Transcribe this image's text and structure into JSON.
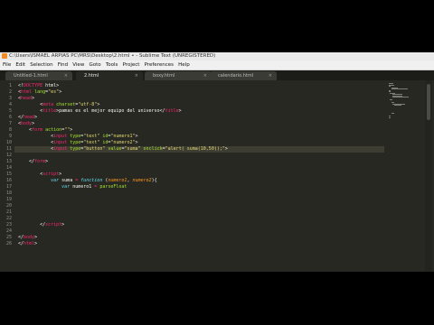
{
  "window": {
    "title": "C:\\Users\\ISMAEL ARPIAS PC\\MRS\\Desktop\\2.html • - Sublime Text (UNREGISTERED)"
  },
  "menu": [
    "File",
    "Edit",
    "Selection",
    "Find",
    "View",
    "Goto",
    "Tools",
    "Project",
    "Preferences",
    "Help"
  ],
  "tabs": [
    {
      "label": "Untitled-1.html",
      "active": false
    },
    {
      "label": "2.html",
      "active": true
    },
    {
      "label": "boxy.html",
      "active": false
    },
    {
      "label": "calendario.html",
      "active": false
    }
  ],
  "editor": {
    "current_line": 11,
    "lines": [
      [
        [
          "<!",
          ""
        ],
        [
          "DOCTYPE",
          "tag"
        ],
        [
          " html>",
          ""
        ]
      ],
      [
        [
          "<",
          ""
        ],
        [
          "html",
          "tag"
        ],
        [
          " ",
          ""
        ],
        [
          "lang",
          "attr"
        ],
        [
          "=",
          ""
        ],
        [
          "\"es\"",
          "str"
        ],
        [
          ">",
          ""
        ]
      ],
      [
        [
          "<",
          ""
        ],
        [
          "head",
          "tag"
        ],
        [
          ">",
          ""
        ]
      ],
      [
        [
          "        <",
          ""
        ],
        [
          "meta",
          "tag"
        ],
        [
          " ",
          ""
        ],
        [
          "charset",
          "attr"
        ],
        [
          "=",
          ""
        ],
        [
          "\"utf-8\"",
          "str"
        ],
        [
          ">",
          ""
        ]
      ],
      [
        [
          "        <",
          ""
        ],
        [
          "title",
          "tag"
        ],
        [
          ">pamas es el mejor equipo del universo</",
          ""
        ],
        [
          "title",
          "tag"
        ],
        [
          ">",
          ""
        ]
      ],
      [
        [
          "</",
          ""
        ],
        [
          "head",
          "tag"
        ],
        [
          ">",
          ""
        ]
      ],
      [
        [
          "<",
          ""
        ],
        [
          "body",
          "tag"
        ],
        [
          ">",
          ""
        ]
      ],
      [
        [
          "    <",
          ""
        ],
        [
          "form",
          "tag"
        ],
        [
          " ",
          ""
        ],
        [
          "action",
          "attr"
        ],
        [
          "=",
          ""
        ],
        [
          "\"\"",
          "str"
        ],
        [
          ">",
          ""
        ]
      ],
      [
        [
          "            <",
          ""
        ],
        [
          "input",
          "tag"
        ],
        [
          " ",
          ""
        ],
        [
          "type",
          "attr"
        ],
        [
          "=",
          ""
        ],
        [
          "\"text\"",
          "str"
        ],
        [
          " ",
          ""
        ],
        [
          "id",
          "attr"
        ],
        [
          "=",
          ""
        ],
        [
          "\"numero1\"",
          "str"
        ],
        [
          ">",
          ""
        ]
      ],
      [
        [
          "            <",
          ""
        ],
        [
          "input",
          "tag"
        ],
        [
          " ",
          ""
        ],
        [
          "type",
          "attr"
        ],
        [
          "=",
          ""
        ],
        [
          "\"text\"",
          "str"
        ],
        [
          " ",
          ""
        ],
        [
          "id",
          "attr"
        ],
        [
          "=",
          ""
        ],
        [
          "\"numero2\"",
          "str"
        ],
        [
          ">",
          ""
        ]
      ],
      [
        [
          "            <",
          ""
        ],
        [
          "input",
          "tag"
        ],
        [
          " ",
          ""
        ],
        [
          "type",
          "attr"
        ],
        [
          "=",
          ""
        ],
        [
          "\"button\"",
          "str"
        ],
        [
          " ",
          ""
        ],
        [
          "value",
          "attr"
        ],
        [
          "=",
          ""
        ],
        [
          "\"suma\"",
          "str"
        ],
        [
          " ",
          ""
        ],
        [
          "onclick",
          "attr"
        ],
        [
          "=",
          ""
        ],
        [
          "\"alert( suma(10,50));\"",
          "str"
        ],
        [
          ">",
          ""
        ]
      ],
      [
        [
          "",
          ""
        ]
      ],
      [
        [
          "    </",
          ""
        ],
        [
          "form",
          "tag"
        ],
        [
          ">",
          ""
        ]
      ],
      [
        [
          "",
          ""
        ]
      ],
      [
        [
          "        <",
          ""
        ],
        [
          "script",
          "tag"
        ],
        [
          ">",
          ""
        ]
      ],
      [
        [
          "            ",
          ""
        ],
        [
          "var",
          "kw"
        ],
        [
          " suma ",
          ""
        ],
        [
          "=",
          "tag"
        ],
        [
          " ",
          ""
        ],
        [
          "function",
          "kw"
        ],
        [
          " (",
          ""
        ],
        [
          "numero1",
          "prm"
        ],
        [
          ", ",
          ""
        ],
        [
          "numero2",
          "prm"
        ],
        [
          "){",
          ""
        ]
      ],
      [
        [
          "                ",
          ""
        ],
        [
          "var",
          "kw"
        ],
        [
          " numero1 ",
          ""
        ],
        [
          "=",
          "tag"
        ],
        [
          " ",
          ""
        ],
        [
          "parseFloat",
          "fn"
        ]
      ],
      [
        [
          "",
          ""
        ]
      ],
      [
        [
          "",
          ""
        ]
      ],
      [
        [
          "",
          ""
        ]
      ],
      [
        [
          "",
          ""
        ]
      ],
      [
        [
          "",
          ""
        ]
      ],
      [
        [
          "        </",
          ""
        ],
        [
          "script",
          "tag"
        ],
        [
          ">",
          ""
        ]
      ],
      [
        [
          "",
          ""
        ]
      ],
      [
        [
          "</",
          ""
        ],
        [
          "body",
          "tag"
        ],
        [
          ">",
          ""
        ]
      ],
      [
        [
          "</",
          ""
        ],
        [
          "html",
          "tag"
        ],
        [
          ">",
          ""
        ]
      ]
    ]
  },
  "colors": {
    "editor_bg": "#272822",
    "tag": "#f92672",
    "attribute": "#a6e22e",
    "string": "#e6db74",
    "keyword": "#66d9ef"
  }
}
